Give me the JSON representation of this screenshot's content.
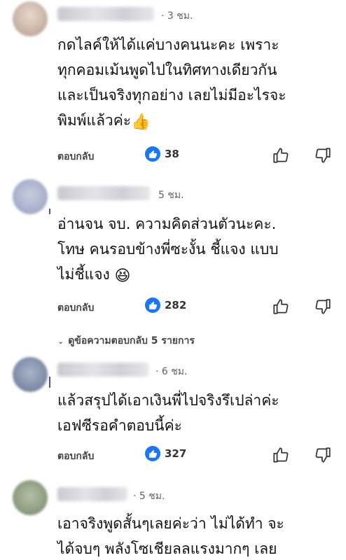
{
  "comments": [
    {
      "time": "· 3 ชม.",
      "lines": [
        "กดไลค์ให้ได้แค่บางคนนะคะ เพราะ",
        "ทุกคอมเม้นพูดไปในทิศทางเดียวกัน",
        "และเป็นจริงทุกอย่าง เลยไม่มีอะไรจะ",
        "พิมพ์แล้วค่ะ"
      ],
      "emoji": "👍",
      "reply_label": "ตอบกลับ",
      "like_count": "38"
    },
    {
      "time": "5 ชม.",
      "lines": [
        "อ่านจน จบ. ความคิดส่วนตัวนะคะ.",
        "โทษ คนรอบข้างพี่ซะงั้น  ชี้แจง แบบ",
        "ไม่ชี้แจง"
      ],
      "emoji": "😆",
      "reply_label": "ตอบกลับ",
      "like_count": "282",
      "view_replies": "ดูข้อความตอบกลับ 5 รายการ"
    },
    {
      "time": "· 6 ชม.",
      "lines": [
        "แล้วสรุปได้เอาเงินพี่ไปจริงรึเปล่าค่ะ",
        "เอฟซีรอคำตอบนี้ค่ะ"
      ],
      "reply_label": "ตอบกลับ",
      "like_count": "327"
    },
    {
      "time": "· 5 ชม.",
      "lines": [
        "เอาจริงพูดสั้นๆเลยค่ะว่า ไม่ได้ทำ จะ",
        "ได้จบๆ พลังโซเชียลลแรงมากๆ เลย"
      ]
    }
  ],
  "icons": {
    "like_badge": "thumbs-up-icon",
    "thumb_up": "thumbs-up-outline-icon",
    "thumb_down": "thumbs-down-outline-icon",
    "chevron": "chevron-down-icon"
  },
  "colors": {
    "like_blue": "#1877f2",
    "thread_line": "#6b3fa0"
  }
}
